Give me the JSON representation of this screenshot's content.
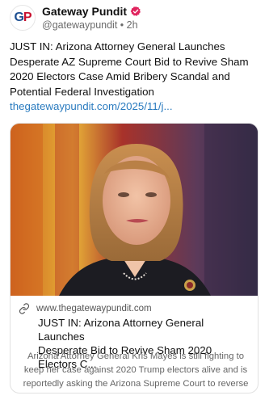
{
  "account": {
    "avatar_text_g": "G",
    "avatar_text_p": "P",
    "name": "Gateway Pundit",
    "handle": "@gatewaypundit",
    "separator": "•",
    "time": "2h",
    "verified_color": "#e0245e"
  },
  "post": {
    "text": "JUST IN: Arizona Attorney General Launches Desperate AZ Supreme Court Bid to Revive Sham 2020 Electors Case Amid Bribery Scandal and Potential Federal Investigation",
    "link": "thegatewaypundit.com/2025/11/j..."
  },
  "card": {
    "domain": "www.thegatewaypundit.com",
    "title_line1": "JUST IN: Arizona Attorney General Launches",
    "title_line2": "Desperate Bid to Revive Sham 2020 Electors C...",
    "description": "Arizona Attorney General Kris Mayes is still fighting to keep her case against 2020 Trump electors alive and is reportedly asking the Arizona Supreme Court to reverse the dismissal of her case after mislea..."
  },
  "colors": {
    "link": "#2a7bbf",
    "brand_blue": "#1d4f91",
    "brand_red": "#c8102e"
  }
}
